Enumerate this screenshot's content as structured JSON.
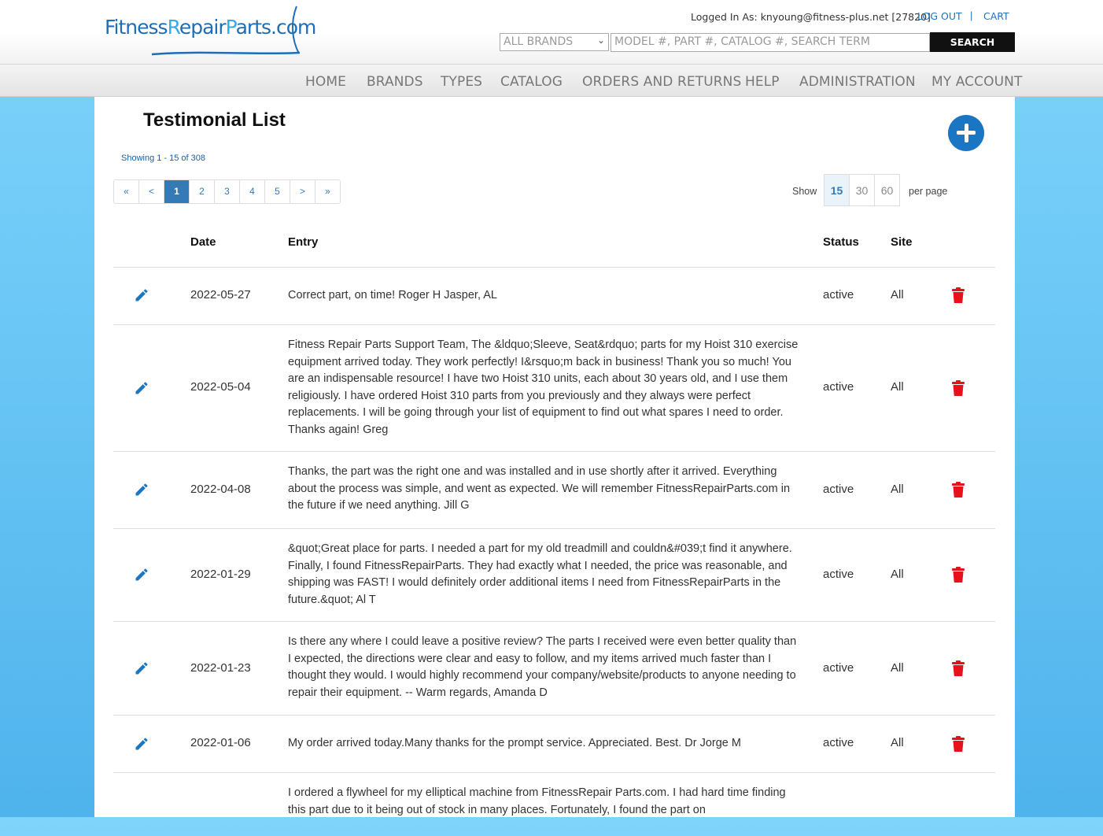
{
  "logo": {
    "text_a": "Fitness",
    "text_b": "R",
    "text_c": "epair",
    "text_d": "P",
    "text_e": "arts.com"
  },
  "header": {
    "login_text": "Logged In As: knyoung@fitness-plus.net [27820]",
    "logout": "LOG OUT",
    "separator": "|",
    "cart": "CART",
    "brand_select": "ALL BRANDS",
    "search_placeholder": "MODEL #, PART #, CATALOG #, SEARCH TERM",
    "search_button": "SEARCH"
  },
  "nav": {
    "items": [
      "HOME",
      "BRANDS",
      "TYPES",
      "CATALOG",
      "ORDERS AND RETURNS",
      "HELP",
      "ADMINISTRATION",
      "MY ACCOUNT"
    ]
  },
  "page": {
    "title": "Testimonial List",
    "showing": "Showing 1 - 15 of 308",
    "pager": [
      "«",
      "<",
      "1",
      "2",
      "3",
      "4",
      "5",
      ">",
      "»"
    ],
    "pager_active": "1",
    "show_label": "Show",
    "per_page_options": [
      "15",
      "30",
      "60"
    ],
    "per_page_active": "15",
    "per_page_label": "per page"
  },
  "table": {
    "headers": {
      "date": "Date",
      "entry": "Entry",
      "status": "Status",
      "site": "Site"
    },
    "rows": [
      {
        "date": "2022-05-27",
        "entry": "Correct part, on time! Roger H Jasper, AL",
        "status": "active",
        "site": "All"
      },
      {
        "date": "2022-05-04",
        "entry": "Fitness Repair Parts Support Team, The &ldquo;Sleeve, Seat&rdquo; parts for my Hoist 310 exercise equipment arrived today. They work perfectly! I&rsquo;m back in business! Thank you so much! You are an indispensable resource! I have two Hoist 310 units, each about 30 years old, and I use them religiously. I have ordered Hoist 310 parts from you previously and they always were perfect replacements. I will be going through your list of equipment to find out what spares I need to order. Thanks again! Greg",
        "status": "active",
        "site": "All"
      },
      {
        "date": "2022-04-08",
        "entry": "Thanks, the part was the right one and was installed and in use shortly after it arrived. Everything about the process was simple, and went as expected. We will remember FitnessRepairParts.com in the future if we need anything. Jill G",
        "status": "active",
        "site": "All"
      },
      {
        "date": "2022-01-29",
        "entry": "&quot;Great place for parts. I needed a part for my old treadmill and couldn&#039;t find it anywhere. Finally, I found FitnessRepairParts. They had exactly what I needed, the price was reasonable, and shipping was FAST! I would definitely order additional items I need from FitnessRepairParts in the future.&quot; Al T",
        "status": "active",
        "site": "All"
      },
      {
        "date": "2022-01-23",
        "entry": "Is there any where I could leave a positive review? The parts I received were even better quality than I expected, the directions were clear and easy to follow, and my items arrived much faster than I thought they would. I would highly recommend your company/website/products to anyone needing to repair their equipment. -- Warm regards, Amanda D",
        "status": "active",
        "site": "All"
      },
      {
        "date": "2022-01-06",
        "entry": "My order arrived today.Many thanks for the prompt service. Appreciated. Best. Dr Jorge M",
        "status": "active",
        "site": "All"
      },
      {
        "date": "",
        "entry": "I ordered a flywheel for my elliptical machine from FitnessRepair Parts.com. I had hard time finding this part due to it being out of stock in many places. Fortunately, I found the part on",
        "status": "",
        "site": ""
      }
    ]
  },
  "colors": {
    "accent": "#1a75c3",
    "delete": "#e8101a",
    "link": "#1e73be"
  },
  "icons": {
    "edit": "pencil-icon",
    "delete": "trash-icon",
    "add": "plus-icon"
  }
}
